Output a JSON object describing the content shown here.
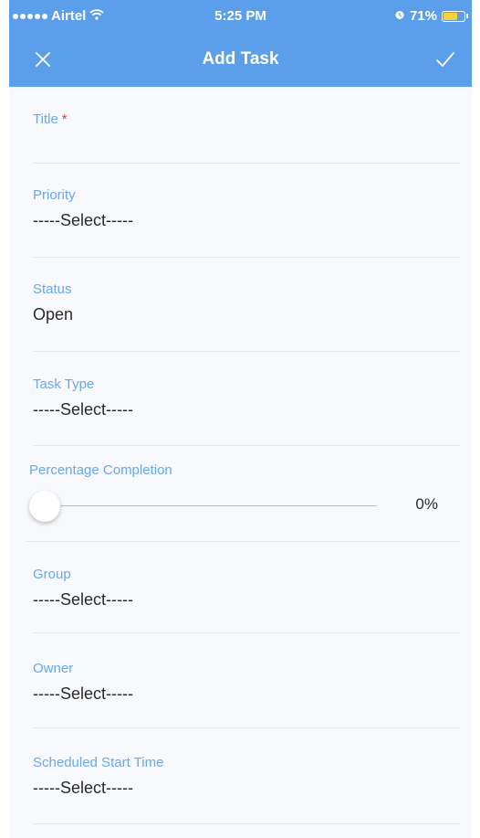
{
  "status_bar": {
    "carrier": "Airtel",
    "time": "5:25 PM",
    "battery": "71%",
    "battery_level": 0.71,
    "icons": [
      "signal-dots-icon",
      "wifi-icon",
      "alarm-icon",
      "battery-icon"
    ]
  },
  "nav": {
    "title": "Add Task",
    "left_icon": "close-icon",
    "right_icon": "check-icon"
  },
  "colors": {
    "header": "#5b9eea",
    "label": "#6aa8ea",
    "required": "#e53935",
    "background": "#f7f9fc",
    "battery": "#f6d33c"
  },
  "form": {
    "title": {
      "label": "Title",
      "required_mark": "*",
      "value": ""
    },
    "priority": {
      "label": "Priority",
      "value": "-----Select-----"
    },
    "status": {
      "label": "Status",
      "value": "Open"
    },
    "task_type": {
      "label": "Task Type",
      "value": "-----Select-----"
    },
    "percentage": {
      "label": "Percentage Completion",
      "value": 0,
      "display": "0%"
    },
    "group": {
      "label": "Group",
      "value": "-----Select-----"
    },
    "owner": {
      "label": "Owner",
      "value": "-----Select-----"
    },
    "scheduled_start": {
      "label": "Scheduled Start Time",
      "value": "-----Select-----"
    }
  }
}
